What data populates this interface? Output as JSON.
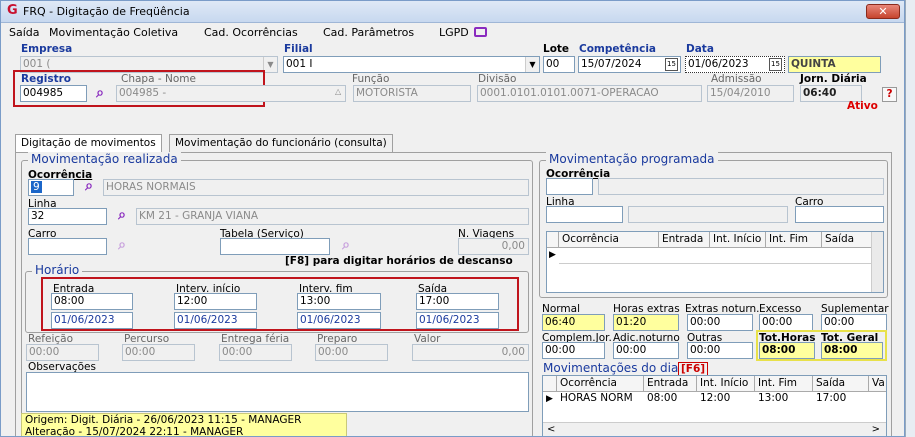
{
  "window": {
    "title": "FRQ - Digitação de Freqüência",
    "close": "✕"
  },
  "menu": {
    "saida": "Saída",
    "mov_coletiva": "Movimentação Coletiva",
    "cad_ocorrencias": "Cad. Ocorrências",
    "cad_parametros": "Cad. Parâmetros",
    "lgpd": "LGPD"
  },
  "header": {
    "empresa_label": "Empresa",
    "empresa_value": "001 (",
    "filial_label": "Filial",
    "filial_value": "001 I",
    "lote_label": "Lote",
    "lote_value": "00",
    "competencia_label": "Competência",
    "competencia_value": "15/07/2024",
    "data_label": "Data",
    "data_value": "01/06/2023",
    "weekday": "QUINTA"
  },
  "registro": {
    "label": "Registro",
    "value": "004985",
    "chapa_nome_label": "Chapa  -  Nome",
    "chapa_nome_value": "004985 -",
    "funcao_label": "Função",
    "funcao_value": "MOTORISTA",
    "divisao_label": "Divisão",
    "divisao_value": "0001.0101.0101.0071-OPERACAO",
    "admissao_label": "Admissão",
    "admissao_value": "15/04/2010",
    "jornada_label": "Jorn. Diária",
    "jornada_value": "06:40",
    "help": "?",
    "status": "Ativo"
  },
  "tabs": {
    "digitacao": "Digitação de movimentos",
    "movimentacao_func": "Movimentação do funcionário (consulta)"
  },
  "realizada": {
    "title": "Movimentação realizada",
    "ocorrencia_label": "Ocorrência",
    "ocorrencia_code": "9",
    "ocorrencia_desc": "HORAS NORMAIS",
    "linha_label": "Linha",
    "linha_code": "32",
    "linha_desc": "KM 21  - GRANJA VIANA",
    "carro_label": "Carro",
    "carro_value": "",
    "tabela_label": "Tabela (Serviço)",
    "tabela_value": "",
    "nviagens_label": "N. Viagens",
    "nviagens_value": "0,00",
    "f8_hint": "[F8] para digitar horários de descanso"
  },
  "horario": {
    "title": "Horário",
    "entrada_label": "Entrada",
    "entrada_time": "08:00",
    "entrada_date": "01/06/2023",
    "interv_inicio_label": "Interv. início",
    "interv_inicio_time": "12:00",
    "interv_inicio_date": "01/06/2023",
    "interv_fim_label": "Interv. fim",
    "interv_fim_time": "13:00",
    "interv_fim_date": "01/06/2023",
    "saida_label": "Saída",
    "saida_time": "17:00",
    "saida_date": "01/06/2023"
  },
  "extras": {
    "refeicao_label": "Refeição",
    "refeicao_value": "00:00",
    "percurso_label": "Percurso",
    "percurso_value": "00:00",
    "entrega_label": "Entrega féria",
    "entrega_value": "00:00",
    "preparo_label": "Preparo",
    "preparo_value": "00:00",
    "valor_label": "Valor",
    "valor_value": "0,00",
    "obs_label": "Observações"
  },
  "origem": {
    "line1": "Origem: Digit. Diária - 26/06/2023 11:15 - MANAGER",
    "line2": "Alteração - 15/07/2024 22:11 - MANAGER"
  },
  "programada": {
    "title": "Movimentação programada",
    "ocorrencia_label": "Ocorrência",
    "linha_label": "Linha",
    "carro_label": "Carro",
    "columns": [
      "Ocorrência",
      "Entrada",
      "Int. Início",
      "Int. Fim",
      "Saída"
    ]
  },
  "totais": {
    "normal_label": "Normal",
    "normal_value": "06:40",
    "extras_label": "Horas extras",
    "extras_value": "01:20",
    "extras_noturn_label": "Extras noturn.",
    "extras_noturn_value": "00:00",
    "excesso_label": "Excesso",
    "excesso_value": "00:00",
    "suplementar_label": "Suplementar",
    "suplementar_value": "00:00",
    "complem_label": "Complem.Jor.",
    "complem_value": "00:00",
    "adic_noturno_label": "Adic.noturno",
    "adic_noturno_value": "00:00",
    "outras_label": "Outras",
    "outras_value": "00:00",
    "tot_horas_label": "Tot.Horas",
    "tot_horas_value": "08:00",
    "tot_geral_label": "Tot. Geral",
    "tot_geral_value": "08:00"
  },
  "mov_dia": {
    "title": "Movimentações do dia",
    "key": "[F6]",
    "columns": [
      "Ocorrência",
      "Entrada",
      "Int. Início",
      "Int. Fim",
      "Saída",
      "Va"
    ],
    "row": [
      "HORAS NORM",
      "08:00",
      "12:00",
      "13:00",
      "17:00",
      ""
    ]
  },
  "icons": {
    "search": "search-icon",
    "calendar": "calendar-icon",
    "dropdown": "chevron-down-icon",
    "message": "message-icon",
    "row_pointer": "row-pointer-icon"
  }
}
